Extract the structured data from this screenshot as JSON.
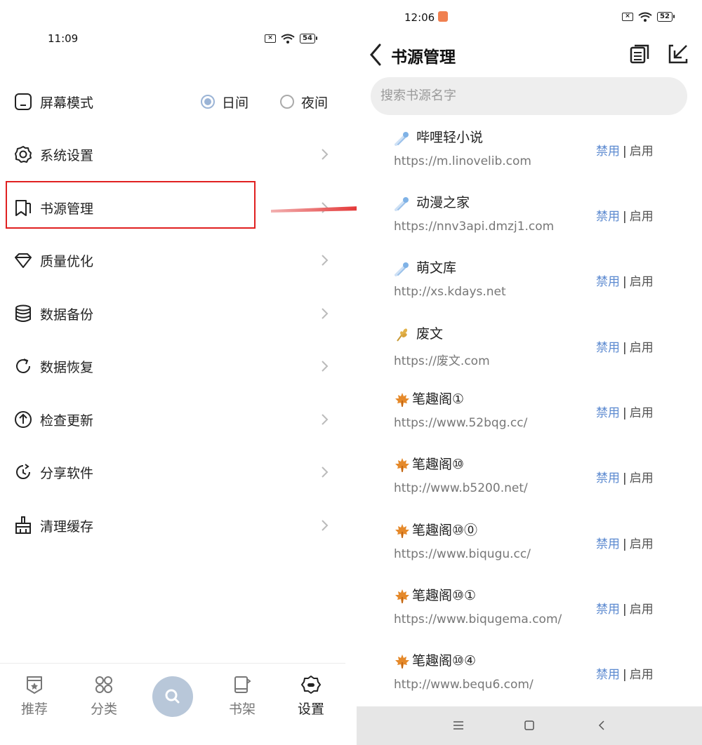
{
  "left": {
    "status_time": "11:09",
    "battery": "54",
    "menu": {
      "screen_mode": {
        "label": "屏幕模式",
        "day": "日间",
        "night": "夜间",
        "selected": "day"
      },
      "items": [
        {
          "label": "系统设置",
          "icon": "gear-icon"
        },
        {
          "label": "书源管理",
          "icon": "bookmark-icon"
        },
        {
          "label": "质量优化",
          "icon": "diamond-icon"
        },
        {
          "label": "数据备份",
          "icon": "database-icon"
        },
        {
          "label": "数据恢复",
          "icon": "refresh-icon"
        },
        {
          "label": "检查更新",
          "icon": "upload-circle-icon"
        },
        {
          "label": "分享软件",
          "icon": "share-icon"
        },
        {
          "label": "清理缓存",
          "icon": "broom-icon"
        }
      ]
    },
    "bottom_nav": [
      {
        "label": "推荐",
        "icon": "badge-star-icon"
      },
      {
        "label": "分类",
        "icon": "grid-icon"
      },
      {
        "label": "",
        "icon": "search-icon"
      },
      {
        "label": "书架",
        "icon": "book-icon"
      },
      {
        "label": "设置",
        "icon": "settings-icon"
      }
    ]
  },
  "right": {
    "status_time": "12:06",
    "battery": "52",
    "header": {
      "title": "书源管理"
    },
    "search": {
      "placeholder": "搜索书源名字"
    },
    "ops": {
      "disable": "禁用",
      "sep": "|",
      "enable": "启用"
    },
    "sources": [
      {
        "icon": "comet-emoji",
        "name": "哔哩轻小说",
        "url": "https://m.linovelib.com"
      },
      {
        "icon": "comet-emoji",
        "name": "动漫之家",
        "url": "https://nnv3api.dmzj1.com"
      },
      {
        "icon": "comet-emoji",
        "name": "萌文库",
        "url": "http://xs.kdays.net"
      },
      {
        "icon": "wheat-emoji",
        "name": "废文",
        "url": "https://废文.com"
      },
      {
        "icon": "maple-leaf-emoji",
        "name": "笔趣阁①",
        "url": "https://www.52bqg.cc/"
      },
      {
        "icon": "maple-leaf-emoji",
        "name": "笔趣阁⑩",
        "url": "http://www.b5200.net/"
      },
      {
        "icon": "maple-leaf-emoji",
        "name": "笔趣阁⑩⓪",
        "url": "https://www.biqugu.cc/"
      },
      {
        "icon": "maple-leaf-emoji",
        "name": "笔趣阁⑩①",
        "url": "https://www.biqugema.com/"
      },
      {
        "icon": "maple-leaf-emoji",
        "name": "笔趣阁⑩④",
        "url": "http://www.bequ6.com/"
      }
    ]
  },
  "colors": {
    "accent": "#5c8ad0",
    "highlight": "#e02020",
    "fab": "#b8c7d9"
  }
}
